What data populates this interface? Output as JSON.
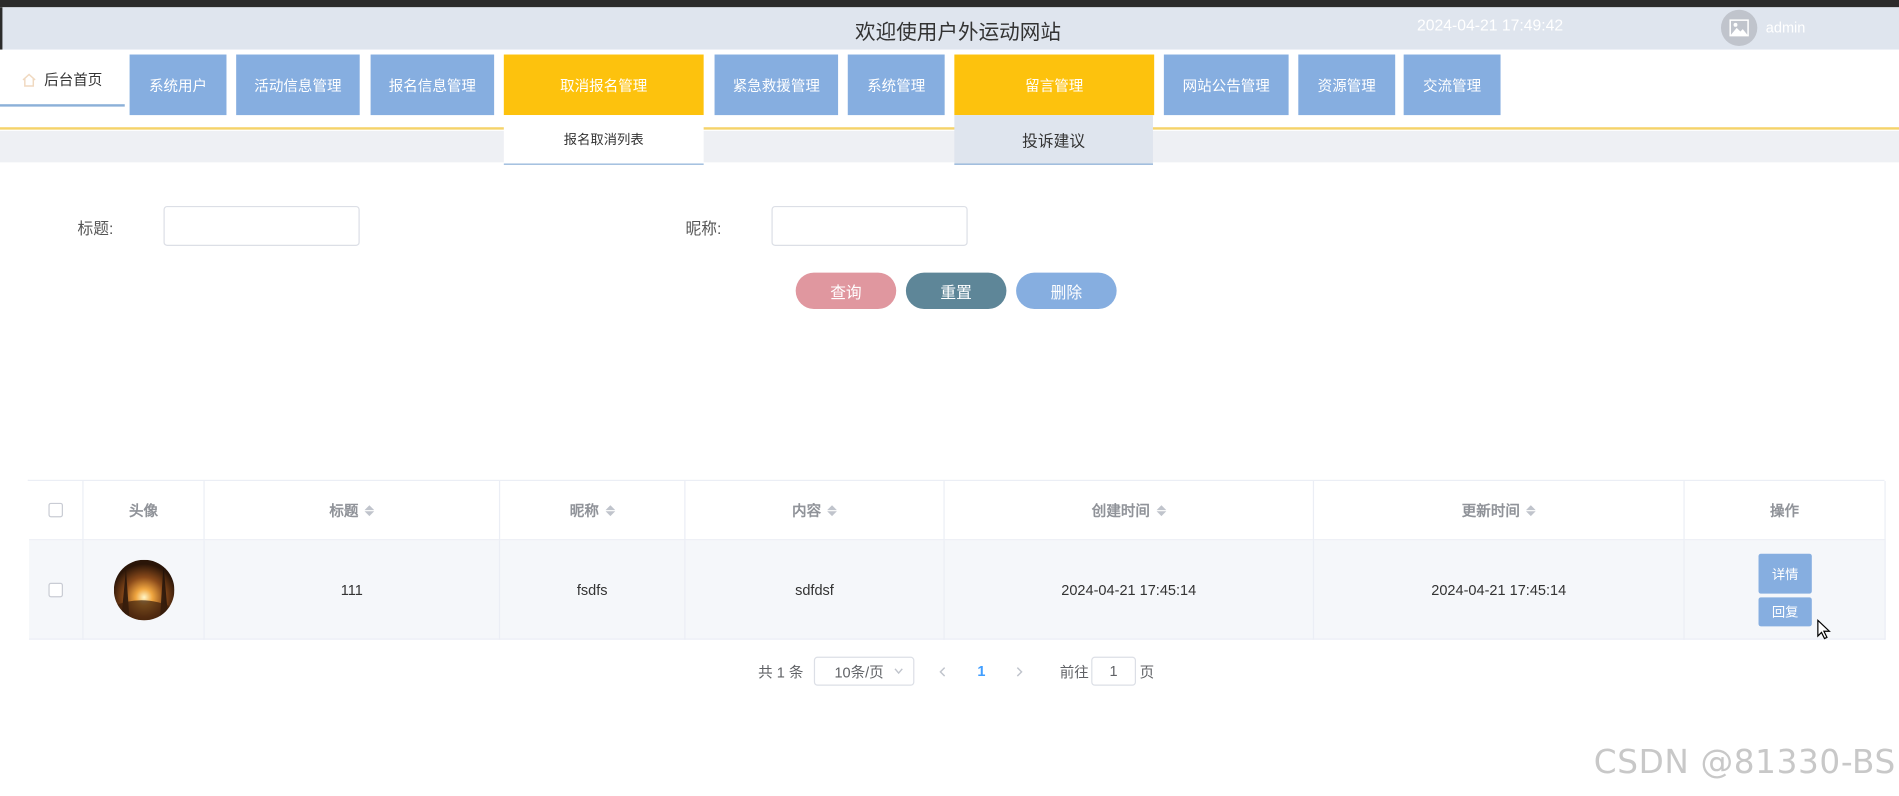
{
  "header": {
    "title": "欢迎使用户外运动网站",
    "datetime": "2024-04-21 17:49:42",
    "username": "admin",
    "avatar_icon": "image-placeholder-icon"
  },
  "nav": {
    "home_label": "后台首页",
    "home_icon": "home-icon",
    "menus": [
      {
        "label": "系统用户",
        "active": false
      },
      {
        "label": "活动信息管理",
        "active": false
      },
      {
        "label": "报名信息管理",
        "active": false
      },
      {
        "label": "取消报名管理",
        "active": true
      },
      {
        "label": "紧急救援管理",
        "active": false
      },
      {
        "label": "系统管理",
        "active": false
      },
      {
        "label": "留言管理",
        "active": true
      },
      {
        "label": "网站公告管理",
        "active": false
      },
      {
        "label": "资源管理",
        "active": false
      },
      {
        "label": "交流管理",
        "active": false
      }
    ],
    "dropdowns": {
      "cancel_signup": "报名取消列表",
      "message": "投诉建议"
    }
  },
  "search": {
    "title_label": "标题:",
    "title_value": "",
    "nickname_label": "昵称:",
    "nickname_value": ""
  },
  "actions": {
    "query": "查询",
    "reset": "重置",
    "delete": "删除"
  },
  "table": {
    "headers": {
      "avatar": "头像",
      "title": "标题",
      "nickname": "昵称",
      "content": "内容",
      "created": "创建时间",
      "updated": "更新时间",
      "ops": "操作"
    },
    "rows": [
      {
        "title": "111",
        "nickname": "fsdfs",
        "content": "sdfdsf",
        "created": "2024-04-21 17:45:14",
        "updated": "2024-04-21 17:45:14",
        "detail_label": "详情",
        "reply_label": "回复"
      }
    ]
  },
  "pagination": {
    "total": "共 1 条",
    "page_size": "10条/页",
    "current": "1",
    "goto_label": "前往",
    "goto_value": "1",
    "page_suffix": "页"
  },
  "watermark": "CSDN @81330-BS",
  "colors": {
    "menu": "#86aee0",
    "menu_active": "#fdc20d",
    "query": "#e0979f",
    "reset": "#5e8698",
    "delete": "#86aee0",
    "header_bg": "#dfe5ee"
  }
}
